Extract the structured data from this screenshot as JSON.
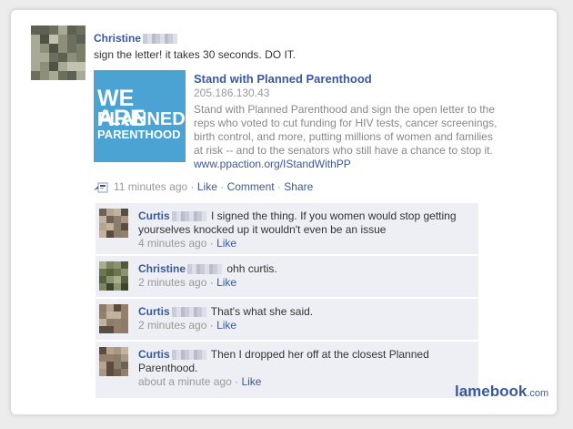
{
  "post": {
    "author": "Christine",
    "text": "sign the letter! it takes 30 seconds. DO IT.",
    "attachment": {
      "logo_lines": [
        "WE ARE",
        "PLANNED",
        "PARENTHOOD"
      ],
      "title": "Stand with Planned Parenthood",
      "subtitle": "205.186.130.43",
      "description": "Stand with Planned Parenthood and sign the open letter to the reps who voted to cut funding for HIV tests, cancer screenings, birth control, and more, putting millions of women and families at risk -- and to the senators who still have a chance to stop it.",
      "url": "www.ppaction.org/IStandWithPP"
    },
    "time": "11 minutes ago",
    "like": "Like",
    "comment": "Comment",
    "share": "Share",
    "sep": "·"
  },
  "comments": [
    {
      "name": "Curtis",
      "text": "I signed the thing. If you women would stop getting yourselves knocked up it wouldn't even be an issue",
      "time": "4 minutes ago",
      "like": "Like"
    },
    {
      "name": "Christine",
      "text": "ohh curtis.",
      "time": "2 minutes ago",
      "like": "Like"
    },
    {
      "name": "Curtis",
      "text": "That's what she said.",
      "time": "2 minutes ago",
      "like": "Like"
    },
    {
      "name": "Curtis",
      "text": "Then I dropped her off at the closest Planned Parenthood.",
      "time": "about a minute ago",
      "like": "Like"
    }
  ],
  "watermark": {
    "brand": "lamebook",
    "tld": ".com"
  },
  "colors": {
    "accent": "#3b5998",
    "comment_bg": "#edeff4",
    "logo_bg": "#4aa3d3"
  }
}
